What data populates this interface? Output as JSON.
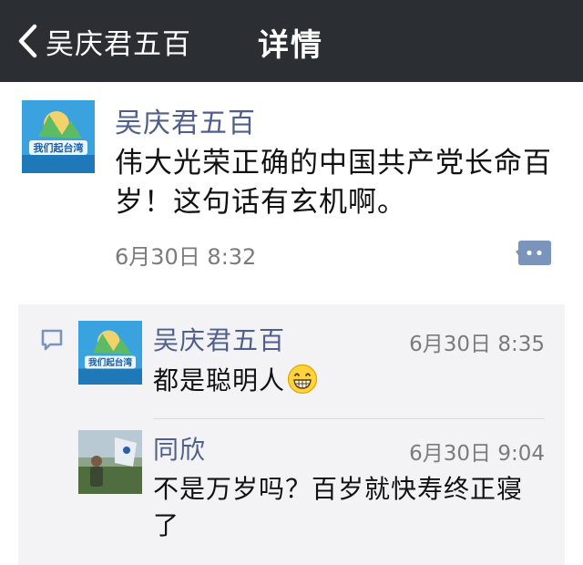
{
  "nav": {
    "back_label": "吴庆君五百",
    "title": "详情"
  },
  "post": {
    "author": "吴庆君五百",
    "text": "伟大光荣正确的中国共产党长命百岁！这句话有玄机啊。",
    "time": "6月30日 8:32",
    "avatar_text": "我们起台湾"
  },
  "comments": [
    {
      "author": "吴庆君五百",
      "time": "6月30日 8:35",
      "text": "都是聪明人",
      "emoji": "grin-emoji"
    },
    {
      "author": "同欣",
      "time": "6月30日 9:04",
      "text": "不是万岁吗？百岁就快寿终正寝了"
    }
  ],
  "colors": {
    "nav_bg": "#2b2e32",
    "name_blue": "#4f5f8a",
    "comment_bg": "#f3f3f5",
    "icon_blue": "#7a94bc"
  }
}
